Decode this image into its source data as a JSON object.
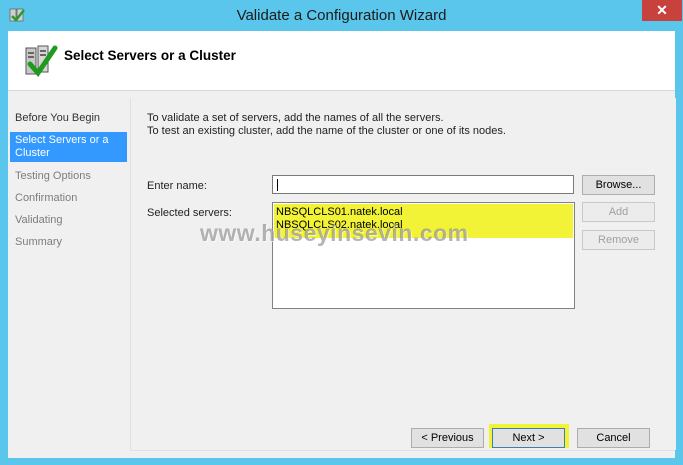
{
  "window": {
    "title": "Validate a Configuration Wizard",
    "close_label": "✕",
    "accent": "#5bc6ec"
  },
  "header": {
    "title": "Select Servers or a Cluster",
    "icon": "cluster-validate-icon"
  },
  "nav": {
    "items": [
      {
        "label": "Before You Begin",
        "state": "done"
      },
      {
        "label": "Select Servers or a Cluster",
        "state": "selected"
      },
      {
        "label": "Testing Options",
        "state": "disabled"
      },
      {
        "label": "Confirmation",
        "state": "disabled"
      },
      {
        "label": "Validating",
        "state": "disabled"
      },
      {
        "label": "Summary",
        "state": "disabled"
      }
    ]
  },
  "content": {
    "instruction_line1": "To validate a set of servers, add the names of all the servers.",
    "instruction_line2": "To test an existing cluster, add the name of the cluster or one of its nodes.",
    "enter_name_label": "Enter name:",
    "enter_name_value": "",
    "browse_label": "Browse...",
    "selected_servers_label": "Selected servers:",
    "add_label": "Add",
    "remove_label": "Remove",
    "servers": [
      "NBSQLCLS01.natek.local",
      "NBSQLCLS02.natek.local"
    ],
    "highlight_color": "#f2f237"
  },
  "watermark": "www.huseyinsevin.com",
  "footer": {
    "previous_label": "< Previous",
    "next_label": "Next >",
    "cancel_label": "Cancel"
  }
}
